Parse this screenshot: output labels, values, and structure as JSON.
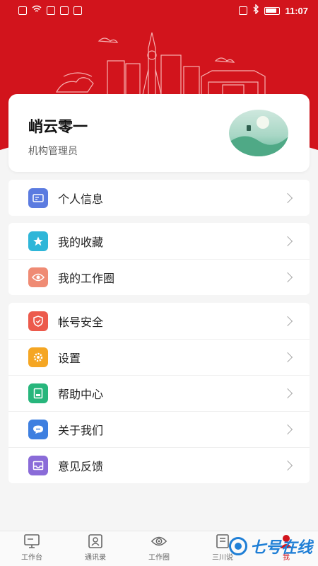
{
  "status_bar": {
    "time": "11:07"
  },
  "profile": {
    "name": "峭云零一",
    "role": "机构管理员"
  },
  "menu_groups": [
    [
      {
        "label": "个人信息",
        "icon": "id-card-icon",
        "color": "#5b7be0"
      }
    ],
    [
      {
        "label": "我的收藏",
        "icon": "star-icon",
        "color": "#2fb6d8"
      },
      {
        "label": "我的工作圈",
        "icon": "eye-icon",
        "color": "#ef8b74"
      }
    ],
    [
      {
        "label": "帐号安全",
        "icon": "shield-icon",
        "color": "#ec5a4c"
      },
      {
        "label": "设置",
        "icon": "gear-icon",
        "color": "#f5a623"
      },
      {
        "label": "帮助中心",
        "icon": "help-book-icon",
        "color": "#27b67c"
      },
      {
        "label": "关于我们",
        "icon": "chat-bubble-icon",
        "color": "#3e7fe0"
      },
      {
        "label": "意见反馈",
        "icon": "inbox-icon",
        "color": "#8a6bd8"
      }
    ]
  ],
  "tabs": [
    {
      "label": "工作台",
      "icon": "monitor-icon"
    },
    {
      "label": "通讯录",
      "icon": "contacts-icon"
    },
    {
      "label": "工作圈",
      "icon": "eye-icon"
    },
    {
      "label": "三川说",
      "icon": "book-icon"
    },
    {
      "label": "我",
      "icon": "user-icon",
      "active": true
    }
  ],
  "watermark": "七号在线",
  "colors": {
    "brand_red": "#d2141c",
    "background": "#f5f5f5"
  }
}
